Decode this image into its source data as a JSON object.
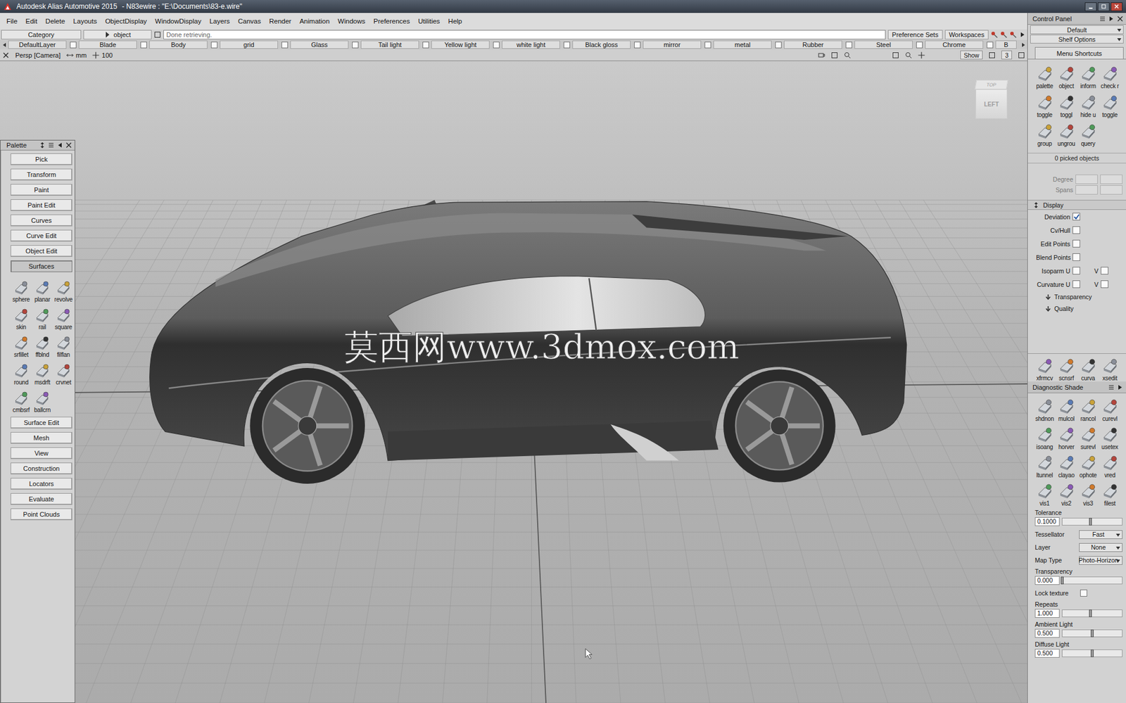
{
  "window": {
    "title": "Autodesk Alias Automotive 2015",
    "document": "- N83ewire : \"E:\\Documents\\83-e.wire\""
  },
  "menu": [
    "File",
    "Edit",
    "Delete",
    "Layouts",
    "ObjectDisplay",
    "WindowDisplay",
    "Layers",
    "Canvas",
    "Render",
    "Animation",
    "Windows",
    "Preferences",
    "Utilities",
    "Help"
  ],
  "toolbar": {
    "category": "Category",
    "pick_mode": "object",
    "status": "Done retrieving.",
    "preference_sets": "Preference Sets",
    "workspaces": "Workspaces"
  },
  "layers": [
    {
      "label": "DefaultLayer",
      "checked": false
    },
    {
      "label": "Blade",
      "checked": false
    },
    {
      "label": "Body",
      "checked": false
    },
    {
      "label": "grid",
      "checked": false
    },
    {
      "label": "Glass",
      "checked": false
    },
    {
      "label": "Tail light",
      "checked": false
    },
    {
      "label": "Yellow light",
      "checked": false
    },
    {
      "label": "white light",
      "checked": false
    },
    {
      "label": "Black gloss",
      "checked": false
    },
    {
      "label": "mirror",
      "checked": false
    },
    {
      "label": "metal",
      "checked": false
    },
    {
      "label": "Rubber",
      "checked": false
    },
    {
      "label": "Steel",
      "checked": false
    },
    {
      "label": "Chrome",
      "checked": false
    },
    {
      "label": "B",
      "checked": false
    }
  ],
  "viewport": {
    "camera": "Persp [Camera]",
    "units": "mm",
    "grid": "100",
    "show": "Show",
    "count": "3",
    "cube_top": "TOP",
    "cube_left": "LEFT",
    "watermark": "莫西网www.3dmox.com"
  },
  "palette": {
    "title": "Palette",
    "sections": [
      {
        "label": "Pick",
        "expanded": false
      },
      {
        "label": "Transform",
        "expanded": false
      },
      {
        "label": "Paint",
        "expanded": false
      },
      {
        "label": "Paint Edit",
        "expanded": false
      },
      {
        "label": "Curves",
        "expanded": false
      },
      {
        "label": "Curve Edit",
        "expanded": false
      },
      {
        "label": "Object Edit",
        "expanded": false
      },
      {
        "label": "Surfaces",
        "expanded": true,
        "tools": [
          "sphere",
          "planar",
          "revolve",
          "skin",
          "rail",
          "square",
          "srfillet",
          "ffblnd",
          "filflan",
          "round",
          "msdrft",
          "crvnet",
          "cmbsrf",
          "ballcrn"
        ]
      },
      {
        "label": "Surface Edit",
        "expanded": false
      },
      {
        "label": "Mesh",
        "expanded": false
      },
      {
        "label": "View",
        "expanded": false
      },
      {
        "label": "Construction",
        "expanded": false
      },
      {
        "label": "Locators",
        "expanded": false
      },
      {
        "label": "Evaluate",
        "expanded": false
      },
      {
        "label": "Point Clouds",
        "expanded": false
      }
    ]
  },
  "control_panel": {
    "title": "Control Panel",
    "preset": "Default",
    "shelf_options": "Shelf Options",
    "tab": "Menu Shortcuts",
    "shortcuts": [
      "palette",
      "object",
      "inform",
      "check r",
      "toggle",
      "toggl",
      "hide u",
      "toggle",
      "group",
      "ungrou",
      "query"
    ],
    "picked": "0 picked objects",
    "fields": [
      "Degree",
      "Spans"
    ],
    "display": {
      "title": "Display",
      "expanded": true,
      "options": [
        {
          "label": "Deviation",
          "checked": true
        },
        {
          "label": "Cv/Hull",
          "checked": false
        },
        {
          "label": "Edit Points",
          "checked": false
        },
        {
          "label": "Blend Points",
          "checked": false
        },
        {
          "label": "Isoparm U",
          "checked": false,
          "v": "V",
          "v_checked": false
        },
        {
          "label": "Curvature U",
          "checked": false,
          "v": "V",
          "v_checked": false
        }
      ],
      "subsections": [
        "Transparency",
        "Quality"
      ]
    },
    "shelf": [
      "xfrmcv",
      "scnsrf",
      "curva",
      "xsedit"
    ],
    "diagnostic": {
      "title": "Diagnostic Shade",
      "tools": [
        "shdnon",
        "mulcol",
        "rancol",
        "curevl",
        "isoang",
        "horver",
        "surevl",
        "usetex",
        "ltunnel",
        "clayao",
        "ophote",
        "vred",
        "vis1",
        "vis2",
        "vis3",
        "filest"
      ]
    },
    "settings": [
      {
        "kind": "slider",
        "label": "Tolerance",
        "value": "0.1000",
        "level": 0.48
      },
      {
        "kind": "dropdown",
        "label": "Tessellator",
        "value": "Fast"
      },
      {
        "kind": "dropdown",
        "label": "Layer",
        "value": "None"
      },
      {
        "kind": "dropdown",
        "label": "Map Type",
        "value": "Photo-Horizon"
      },
      {
        "kind": "slider",
        "label": "Transparency",
        "value": "0.000",
        "level": 0.0
      },
      {
        "kind": "checkbox",
        "label": "Lock texture",
        "checked": false
      },
      {
        "kind": "slider",
        "label": "Repeats",
        "value": "1.000",
        "level": 0.48
      },
      {
        "kind": "slider",
        "label": "Ambient Light",
        "value": "0.500",
        "level": 0.5
      },
      {
        "kind": "slider",
        "label": "Diffuse Light",
        "value": "0.500",
        "level": 0.5
      }
    ]
  }
}
